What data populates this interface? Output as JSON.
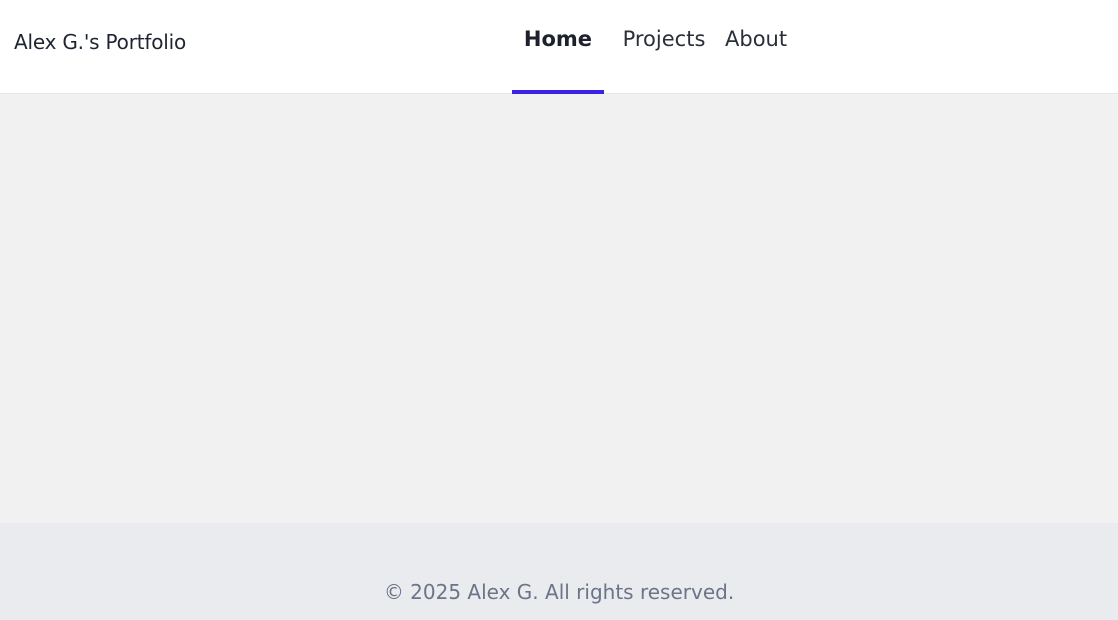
{
  "header": {
    "site_title": "Alex G.'s Portfolio",
    "nav": [
      {
        "label": "Home",
        "active": true
      },
      {
        "label": "Projects",
        "active": false
      },
      {
        "label": "About",
        "active": false
      }
    ]
  },
  "footer": {
    "copyright": "© 2025 Alex G. All rights reserved."
  },
  "colors": {
    "accent": "#3b22e8",
    "text": "#1f2530",
    "footer_text": "#6c7488",
    "background": "#f1f1f2"
  }
}
